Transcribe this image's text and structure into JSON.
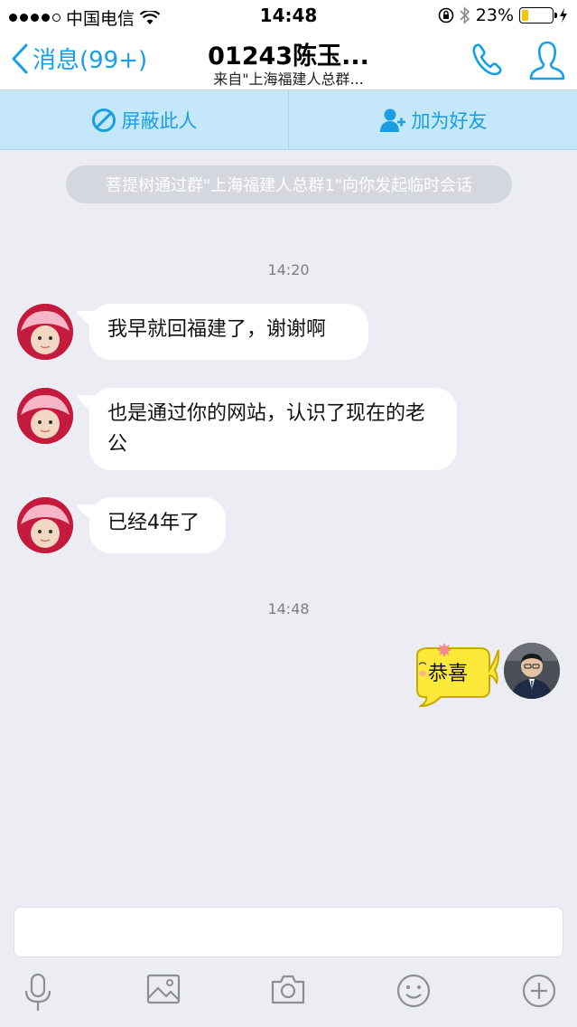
{
  "status_bar": {
    "carrier": "中国电信",
    "time": "14:48",
    "battery_percent": "23%",
    "battery_level": 0.23
  },
  "nav": {
    "back_label": "消息(99+)",
    "title": "01243陈玉...",
    "subtitle": "来自\"上海福建人总群..."
  },
  "actions": {
    "block_label": "屏蔽此人",
    "add_friend_label": "加为好友"
  },
  "system_notice": "菩提树通过群\"上海福建人总群1\"向你发起临时会话",
  "messages": {
    "time_1": "14:20",
    "msg_1": "我早就回福建了，谢谢啊",
    "msg_2": "也是通过你的网站，认识了现在的老公",
    "msg_3": "已经4年了",
    "time_2": "14:48",
    "sticker_text": "恭喜"
  },
  "input": {
    "value": ""
  },
  "colors": {
    "accent": "#14a0e8",
    "action_bar_bg": "#c4e7fa",
    "chat_bg": "#ebedf2",
    "sticker_yellow": "#fde93a"
  },
  "icons": [
    "wifi-icon",
    "lock-rotation-icon",
    "bluetooth-icon",
    "charging-icon",
    "back-chevron-icon",
    "phone-icon",
    "profile-icon",
    "block-icon",
    "add-friend-icon",
    "microphone-icon",
    "image-icon",
    "camera-icon",
    "emoji-icon",
    "plus-icon"
  ]
}
